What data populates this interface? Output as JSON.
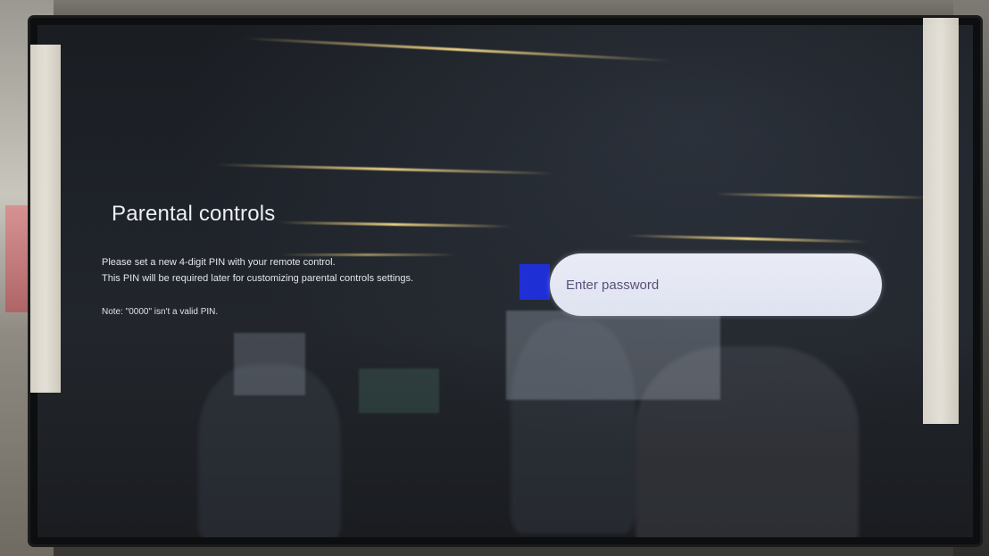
{
  "screen": {
    "title": "Parental controls",
    "description_line1": "Please set a new 4-digit PIN with your remote control.",
    "description_line2": "This PIN will be required later for customizing parental controls settings.",
    "note": "Note: \"0000\" isn't a valid PIN."
  },
  "password_input": {
    "placeholder": "Enter password",
    "value": ""
  },
  "colors": {
    "focus_indicator": "#1f2fd6",
    "input_background": "#e4e8f3",
    "input_text": "#5a4f7a",
    "title_text": "#eceff3"
  }
}
